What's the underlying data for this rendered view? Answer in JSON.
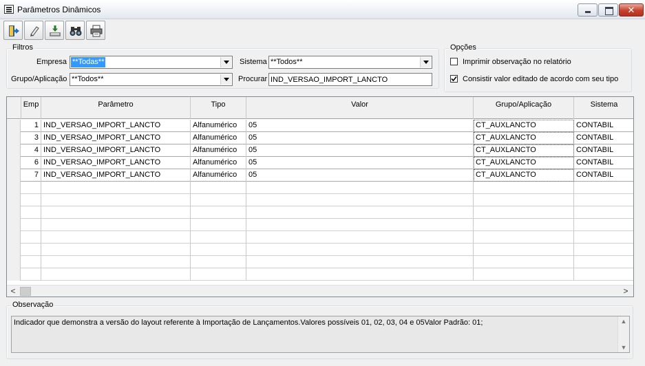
{
  "window": {
    "title": "Parâmetros Dinâmicos",
    "close_glyph": "✕"
  },
  "toolbar": {
    "buttons": [
      {
        "name": "exit-icon"
      },
      {
        "name": "edit-icon"
      },
      {
        "name": "export-icon"
      },
      {
        "name": "binoculars-icon"
      },
      {
        "name": "printer-icon"
      }
    ]
  },
  "filtros": {
    "legend": "Filtros",
    "empresa_label": "Empresa",
    "empresa_value": "**Todas**",
    "sistema_label": "Sistema",
    "sistema_value": "**Todos**",
    "grupo_label": "Grupo/Aplicação",
    "grupo_value": "**Todos**",
    "procurar_label": "Procurar",
    "procurar_value": "IND_VERSAO_IMPORT_LANCTO"
  },
  "opcoes": {
    "legend": "Opções",
    "imprimir_label": "Imprimir observação no relatório",
    "imprimir_checked": false,
    "consistir_label": "Consistir valor editado de acordo com seu tipo",
    "consistir_checked": true
  },
  "grid": {
    "columns": [
      "Emp",
      "Parâmetro",
      "Tipo",
      "Valor",
      "Grupo/Aplicação",
      "Sistema"
    ],
    "rows": [
      {
        "emp": "1",
        "parametro": "IND_VERSAO_IMPORT_LANCTO",
        "tipo": "Alfanumérico",
        "valor": "05",
        "grupo": "CT_AUXLANCTO",
        "sistema": "CONTABIL"
      },
      {
        "emp": "3",
        "parametro": "IND_VERSAO_IMPORT_LANCTO",
        "tipo": "Alfanumérico",
        "valor": "05",
        "grupo": "CT_AUXLANCTO",
        "sistema": "CONTABIL"
      },
      {
        "emp": "4",
        "parametro": "IND_VERSAO_IMPORT_LANCTO",
        "tipo": "Alfanumérico",
        "valor": "05",
        "grupo": "CT_AUXLANCTO",
        "sistema": "CONTABIL"
      },
      {
        "emp": "6",
        "parametro": "IND_VERSAO_IMPORT_LANCTO",
        "tipo": "Alfanumérico",
        "valor": "05",
        "grupo": "CT_AUXLANCTO",
        "sistema": "CONTABIL"
      },
      {
        "emp": "7",
        "parametro": "IND_VERSAO_IMPORT_LANCTO",
        "tipo": "Alfanumérico",
        "valor": "05",
        "grupo": "CT_AUXLANCTO",
        "sistema": "CONTABIL"
      }
    ],
    "scroll_left": "<",
    "scroll_right": ">"
  },
  "observacao": {
    "legend": "Observação",
    "text": "Indicador que demonstra a versão do layout referente à Importação de Lançamentos.Valores possíveis 01, 02, 03, 04 e 05Valor Padrão: 01;",
    "scroll_up": "▲",
    "scroll_down": "▼"
  }
}
